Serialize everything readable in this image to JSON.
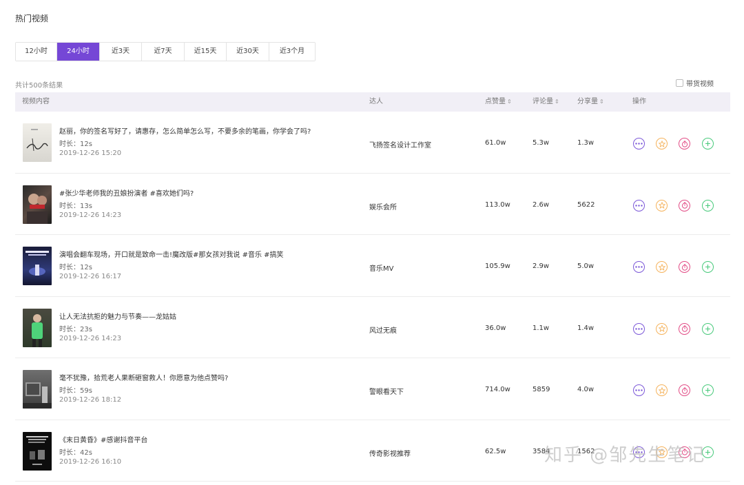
{
  "page_title": "热门视频",
  "tabs": [
    {
      "label": "12小时",
      "active": false
    },
    {
      "label": "24小时",
      "active": true
    },
    {
      "label": "近3天",
      "active": false
    },
    {
      "label": "近7天",
      "active": false
    },
    {
      "label": "近15天",
      "active": false
    },
    {
      "label": "近30天",
      "active": false
    },
    {
      "label": "近3个月",
      "active": false
    }
  ],
  "result_count": "共计500条结果",
  "goods_filter_label": "带货视频",
  "columns": {
    "video": "视频内容",
    "author": "达人",
    "likes": "点赞量",
    "comments": "评论量",
    "shares": "分享量",
    "actions": "操作"
  },
  "sort_icon": "⇕",
  "rows": [
    {
      "title": "赵丽，你的签名写好了，请惠存，怎么简单怎么写，不要多余的笔画，你学会了吗?",
      "duration": "时长：12s",
      "date": "2019-12-26 15:20",
      "author": "飞扬签名设计工作室",
      "likes": "61.0w",
      "comments": "5.3w",
      "shares": "1.3w"
    },
    {
      "title": "#张少华老师我的丑娘扮演者 #喜欢她们吗?",
      "duration": "时长：13s",
      "date": "2019-12-26 14:23",
      "author": "娱乐会所",
      "likes": "113.0w",
      "comments": "2.6w",
      "shares": "5622"
    },
    {
      "title": "演唱会翻车现场，开口就是致命一击!魔改版#那女孩对我说 #音乐 #搞笑",
      "duration": "时长：12s",
      "date": "2019-12-26 16:17",
      "author": "音乐MV",
      "likes": "105.9w",
      "comments": "2.9w",
      "shares": "5.0w"
    },
    {
      "title": "让人无法抗拒的魅力与节奏——龙姑姑",
      "duration": "时长：23s",
      "date": "2019-12-26 14:23",
      "author": "风过无痕",
      "likes": "36.0w",
      "comments": "1.1w",
      "shares": "1.4w"
    },
    {
      "title": "毫不犹豫，拾荒老人果断砸窗救人！你愿意为他点赞吗?",
      "duration": "时长：59s",
      "date": "2019-12-26 18:12",
      "author": "警眼看天下",
      "likes": "714.0w",
      "comments": "5859",
      "shares": "4.0w"
    },
    {
      "title": "《末日黄昏》#感谢抖音平台",
      "duration": "时长：42s",
      "date": "2019-12-26 16:10",
      "author": "传奇影视推荐",
      "likes": "62.5w",
      "comments": "3584",
      "shares": "1562"
    }
  ],
  "watermark": "知乎 @邹先生笔记",
  "colors": {
    "accent": "#7547d6",
    "star": "#f5b25b",
    "timer": "#e24b85",
    "add": "#47c97a"
  }
}
